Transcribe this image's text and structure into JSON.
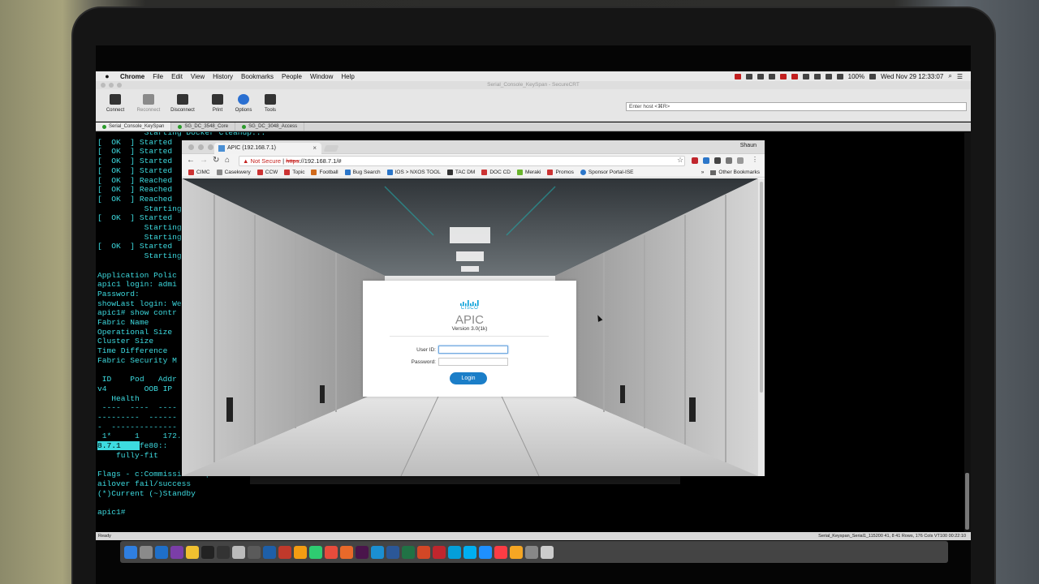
{
  "menubar": {
    "items": [
      "Chrome",
      "File",
      "Edit",
      "View",
      "History",
      "Bookmarks",
      "People",
      "Window",
      "Help"
    ],
    "battery": "100%",
    "datetime": "Wed Nov 29  12:33:07"
  },
  "securecrt": {
    "window_title": "Serial_Console_KeySpan - SecureCRT",
    "toolbar": [
      {
        "label": "Connect",
        "icon": "monitor-icon"
      },
      {
        "label": "Reconnect",
        "icon": "monitor-icon"
      },
      {
        "label": "Disconnect",
        "icon": "monitor-disconnect-icon"
      },
      {
        "label": "Print",
        "icon": "printer-icon"
      },
      {
        "label": "Options",
        "icon": "info-icon"
      },
      {
        "label": "Tools",
        "icon": "gear-icon"
      }
    ],
    "host_placeholder": "Enter host <⌘R>",
    "tabs": [
      "Serial_Console_KeySpan",
      "SG_DC_3548_Core",
      "SG_DC_3048_Access"
    ],
    "status_left": "Ready",
    "status_right": "Serial_Keyspan_Serial1_115200   41,  8   41 Rows, 176 Cols   VT100         00:22:10"
  },
  "terminal": {
    "lines": [
      "          Starting Docker Cleanup...",
      "[  OK  ] Started",
      "[  OK  ] Started",
      "[  OK  ] Started",
      "[  OK  ] Started",
      "[  OK  ] Reached",
      "[  OK  ] Reached",
      "[  OK  ] Reached",
      "          Starting",
      "[  OK  ] Started",
      "          Starting",
      "          Starting",
      "[  OK  ] Started",
      "          Starting",
      "",
      "Application Polic",
      "apic1 login: admi",
      "Password:",
      "showLast login: We",
      "apic1# show contr",
      "Fabric Name",
      "Operational Size",
      "Cluster Size",
      "Time Difference",
      "Fabric Security M",
      "",
      " ID    Pod   Addr",
      "v4        OOB IP",
      "   Health",
      " ----  ----  ----",
      "---------  ------",
      "-  --------------",
      " 1*     1     172.",
      "        fe80::",
      "    fully-fit",
      "",
      "Flags - c:Commissioned | r:Re",
      "ailover fail/success",
      "(*)Current (~)Standby",
      "",
      "apic1#"
    ],
    "highlight_text": "8.7.1"
  },
  "chrome": {
    "tab_title": "APIC (192.168.7.1)",
    "profile": "Shaun",
    "security_label": "Not Secure",
    "url_scheme": "https",
    "url_rest": "://192.168.7.1/#",
    "bookmarks": [
      "CIMC",
      "Casekwery",
      "CCW",
      "Topic",
      "Football",
      "Bug Search",
      "IOS > NXOS TOOL",
      "TAC DM",
      "DOC CD",
      "Meraki",
      "Promos",
      "Sponsor Portal-ISE"
    ],
    "other_bookmarks": "Other Bookmarks"
  },
  "apic_login": {
    "brand": "CISCO",
    "product": "APIC",
    "version": "Version 3.0(1k)",
    "user_label": "User ID:",
    "password_label": "Password:",
    "button": "Login"
  },
  "dock": {
    "apps": [
      "finder-icon",
      "launchpad-icon",
      "outlook-icon",
      "onenote-icon",
      "notes-icon",
      "terminal-icon",
      "securecrt-icon",
      "preview-icon",
      "vmware-icon",
      "network-icon",
      "filezilla-icon",
      "sublime-icon",
      "pycharm-icon",
      "chrome-icon",
      "firefox-icon",
      "slack-icon",
      "safari-icon",
      "word-icon",
      "excel-icon",
      "powerpoint-icon",
      "acrobat-icon",
      "webex-icon",
      "skype-icon",
      "appstore-icon",
      "music-icon",
      "photos-icon",
      "settings-icon",
      "trash-icon"
    ]
  },
  "colors": {
    "terminal_text": "#3ddbe0",
    "cisco_blue": "#049fd9",
    "login_button": "#1b7ec8",
    "not_secure": "#c5221f"
  }
}
